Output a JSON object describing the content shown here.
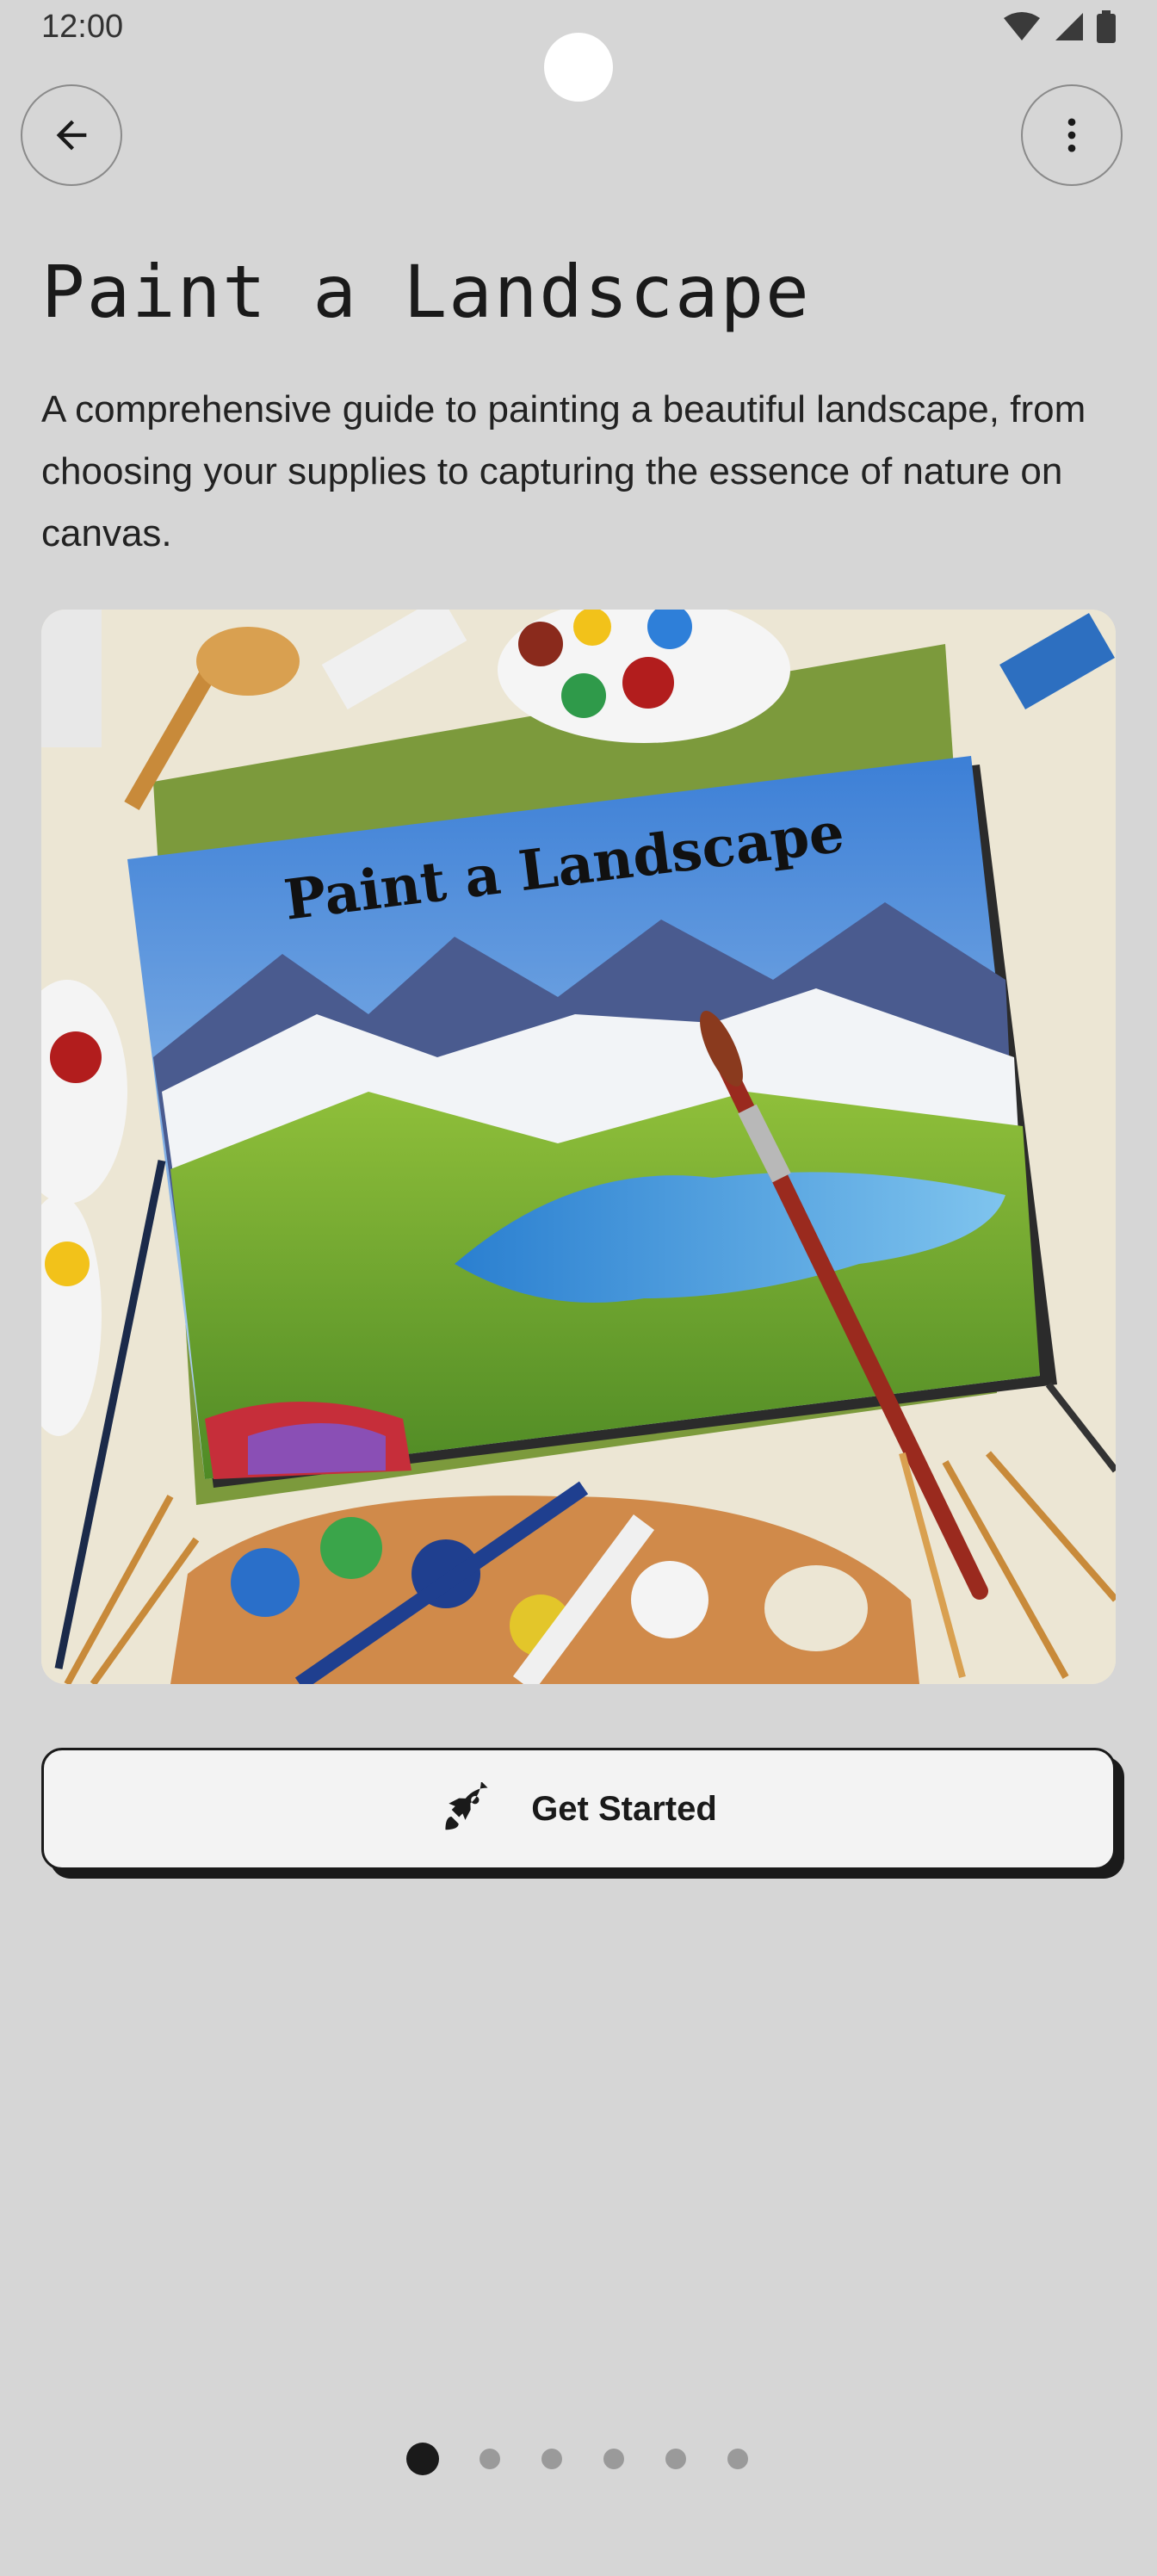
{
  "status_bar": {
    "time": "12:00"
  },
  "header": {
    "back_icon": "arrow-left-icon",
    "menu_icon": "more-vertical-icon"
  },
  "main": {
    "title": "Paint a Landscape",
    "description": "A comprehensive guide to painting a beautiful landscape, from choosing your supplies to capturing the essence of nature on canvas.",
    "hero_book_title": "Paint a Landscape",
    "cta_label": "Get Started",
    "cta_icon": "rocket-icon"
  },
  "pagination": {
    "total": 6,
    "active_index": 0
  },
  "colors": {
    "background": "#d6d6d6",
    "button_bg": "#f3f3f3",
    "button_border": "#1a1a1a"
  }
}
